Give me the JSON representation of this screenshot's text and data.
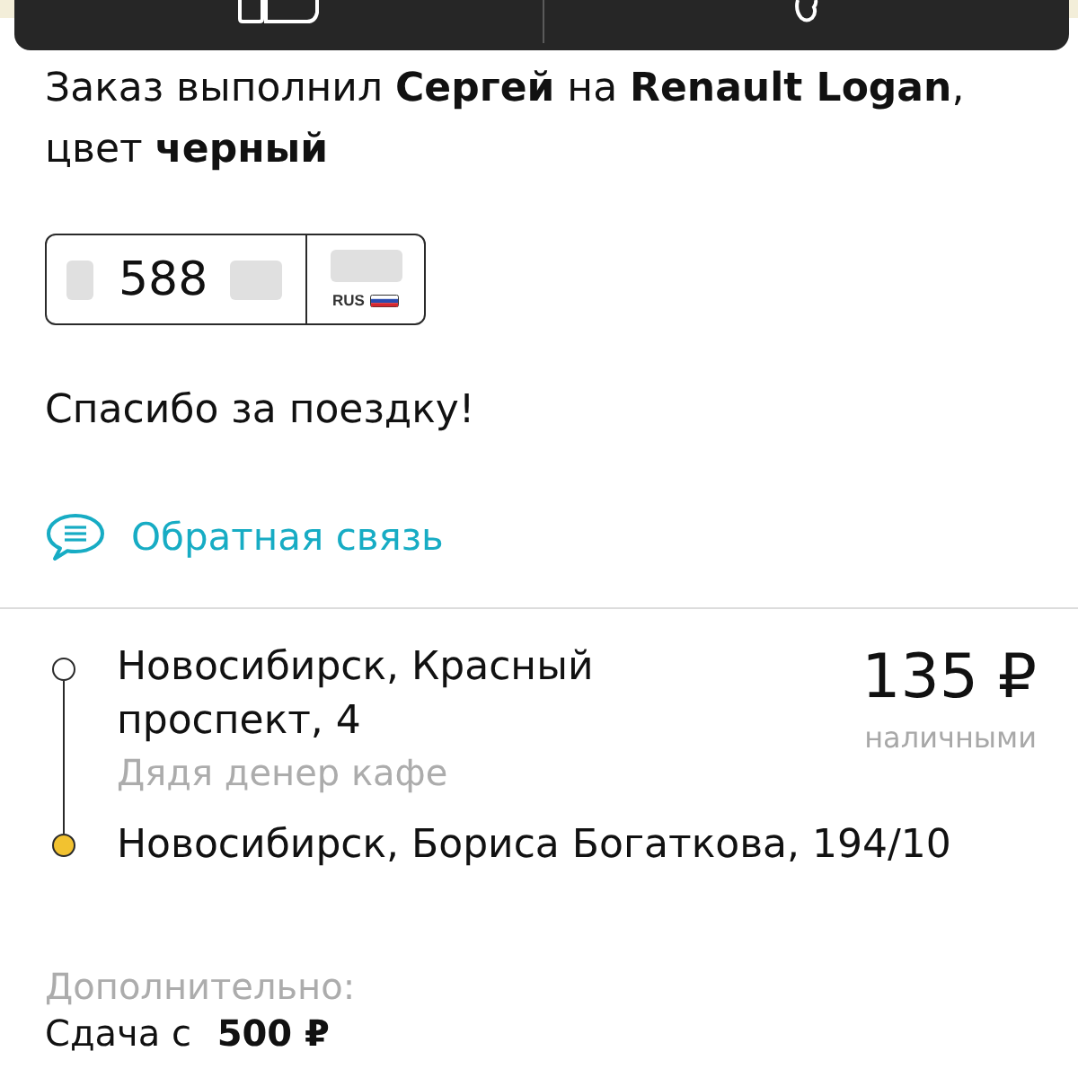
{
  "driver_info": "Заказ выполнил **Сергей** на **Renault Logan**, цвет **черный**",
  "plate": {
    "number": "588",
    "region_label": "RUS"
  },
  "thanks": "Спасибо за поездку!",
  "feedback_link": {
    "label": "Обратная связь"
  },
  "route": {
    "points": [
      {
        "address": "Новосибирск, Красный проспект, 4",
        "note": "Дядя денер кафе",
        "color": "#ffffff"
      },
      {
        "address": "Новосибирск, Бориса Богаткова, 194/10",
        "color": "#f2c230"
      }
    ]
  },
  "price": {
    "amount": "135 ₽",
    "payment": "наличными"
  },
  "extra": {
    "title": "Дополнительно:",
    "text": "Сдача с **500 ₽**"
  }
}
